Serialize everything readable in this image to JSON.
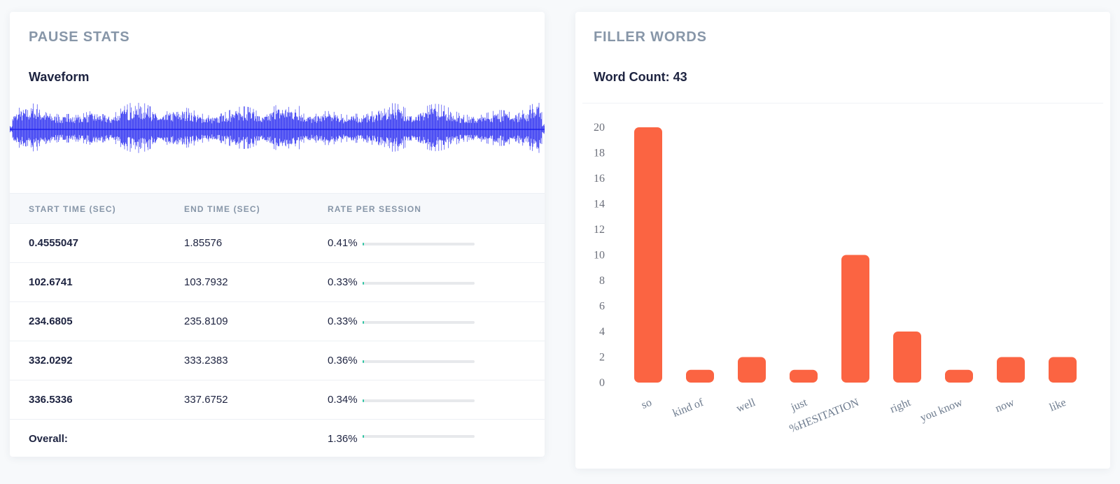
{
  "pause_stats": {
    "title": "PAUSE STATS",
    "waveform_label": "Waveform",
    "waveform_color": "#1f22f0",
    "columns": [
      "START TIME (SEC)",
      "END TIME (SEC)",
      "RATE PER SESSION"
    ],
    "rows": [
      {
        "start": "0.4555047",
        "end": "1.85576",
        "rate": "0.41%",
        "rate_value": 0.0041
      },
      {
        "start": "102.6741",
        "end": "103.7932",
        "rate": "0.33%",
        "rate_value": 0.0033
      },
      {
        "start": "234.6805",
        "end": "235.8109",
        "rate": "0.33%",
        "rate_value": 0.0033
      },
      {
        "start": "332.0292",
        "end": "333.2383",
        "rate": "0.36%",
        "rate_value": 0.0036
      },
      {
        "start": "336.5336",
        "end": "337.6752",
        "rate": "0.34%",
        "rate_value": 0.0034
      }
    ],
    "overall": {
      "label": "Overall:",
      "rate": "1.36%",
      "rate_value": 0.0136
    },
    "rate_bar_color": "#2ec4a2"
  },
  "filler_words": {
    "title": "FILLER WORDS",
    "word_count_label": "Word Count: 43"
  },
  "chart_data": {
    "type": "bar",
    "categories": [
      "so",
      "kind of",
      "well",
      "just",
      "%HESITATION",
      "right",
      "you know",
      "now",
      "like"
    ],
    "values": [
      20,
      1,
      2,
      1,
      10,
      4,
      1,
      2,
      2
    ],
    "ylim": [
      0,
      20
    ],
    "yticks": [
      0,
      2,
      4,
      6,
      8,
      10,
      12,
      14,
      16,
      18,
      20
    ],
    "grid": false,
    "bar_color": "#fb6442",
    "title": "",
    "xlabel": "",
    "ylabel": ""
  }
}
